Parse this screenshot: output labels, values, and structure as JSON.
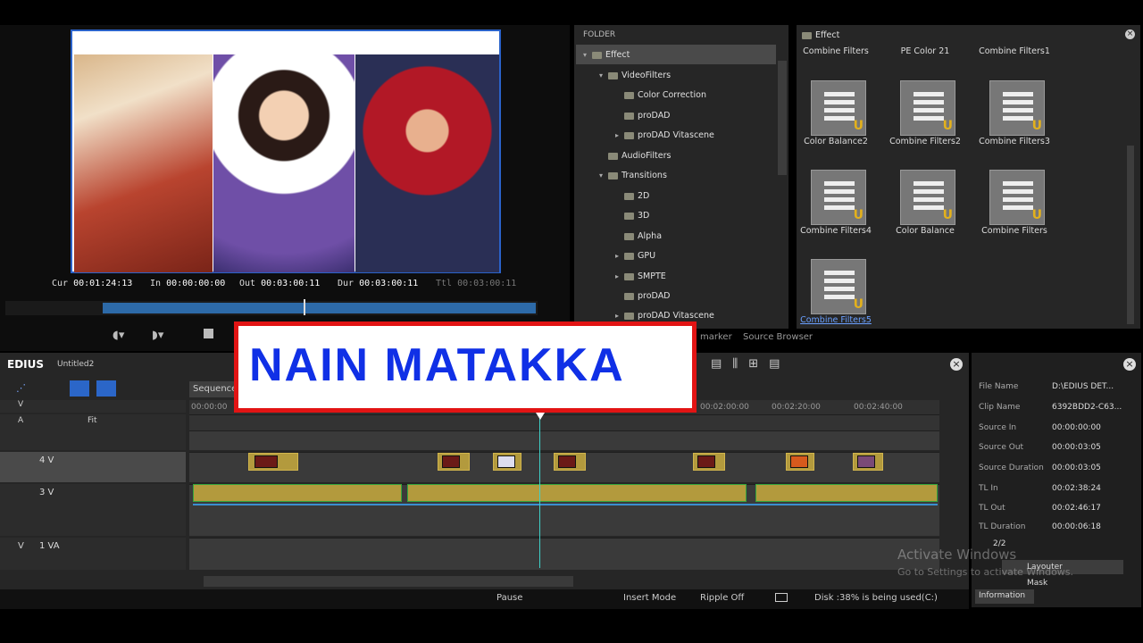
{
  "preview": {
    "cur_label": "Cur",
    "cur": "00:01:24:13",
    "in_label": "In",
    "in": "00:00:00:00",
    "out_label": "Out",
    "out": "00:03:00:11",
    "dur_label": "Dur",
    "dur": "00:03:00:11",
    "ttl_label": "Ttl",
    "ttl": "00:03:00:11"
  },
  "folder": {
    "title": "FOLDER",
    "items": [
      {
        "label": "Effect",
        "expanded": true
      },
      {
        "label": "VideoFilters",
        "expanded": true
      },
      {
        "label": "Color Correction"
      },
      {
        "label": "proDAD"
      },
      {
        "label": "proDAD Vitascene",
        "expanded": false
      },
      {
        "label": "AudioFilters"
      },
      {
        "label": "Transitions",
        "expanded": true
      },
      {
        "label": "2D"
      },
      {
        "label": "3D"
      },
      {
        "label": "Alpha"
      },
      {
        "label": "GPU",
        "expanded": false
      },
      {
        "label": "SMPTE",
        "expanded": false
      },
      {
        "label": "proDAD"
      },
      {
        "label": "proDAD Vitascene",
        "expanded": false
      }
    ]
  },
  "effect": {
    "title": "Effect",
    "headers": [
      "Combine Filters",
      "PE Color 21",
      "Combine Filters1"
    ],
    "items": [
      {
        "label": "Color Balance2",
        "icon": "sliders-icon"
      },
      {
        "label": "Combine Filters2",
        "icon": "layers-icon"
      },
      {
        "label": "Combine Filters3",
        "icon": "layers-icon"
      },
      {
        "label": "Combine Filters4",
        "icon": "layers-icon"
      },
      {
        "label": "Color Balance",
        "icon": "sliders-icon"
      },
      {
        "label": "Combine Filters",
        "icon": "layers-icon"
      },
      {
        "label": "Combine Filters5",
        "icon": "layers-icon",
        "selected": true
      }
    ],
    "tabs": [
      "marker",
      "Source Browser"
    ]
  },
  "app": {
    "name": "EDIUS",
    "project": "Untitled2"
  },
  "timeline": {
    "sequence_tab": "Sequence",
    "ruler": [
      "00:00:00",
      "00:02:00:00",
      "00:02:20:00",
      "00:02:40:00"
    ],
    "tracks": [
      {
        "type": "V",
        "name": ""
      },
      {
        "type": "A",
        "name": "Fit"
      },
      {
        "type": "",
        "name": "4 V"
      },
      {
        "type": "",
        "name": "3 V"
      },
      {
        "type": "V",
        "name": "1 VA"
      }
    ]
  },
  "status": {
    "pause": "Pause",
    "insert": "Insert Mode",
    "ripple": "Ripple Off",
    "disk": "Disk :38% is being used(C:)"
  },
  "info": {
    "rows": [
      {
        "k": "File Name",
        "v": "D:\\EDIUS DET..."
      },
      {
        "k": "Clip Name",
        "v": "6392BDD2-C63..."
      },
      {
        "k": "Source In",
        "v": "00:00:00:00"
      },
      {
        "k": "Source Out",
        "v": "00:00:03:05"
      },
      {
        "k": "Source Duration",
        "v": "00:00:03:05"
      },
      {
        "k": "TL In",
        "v": "00:02:38:24"
      },
      {
        "k": "TL Out",
        "v": "00:02:46:17"
      },
      {
        "k": "TL Duration",
        "v": "00:00:06:18"
      }
    ],
    "count": "2/2",
    "layer1": "Layouter",
    "layer2": "Mask",
    "tab": "Information"
  },
  "banner": {
    "text": "NAIN MATAKKA"
  },
  "watermark": {
    "line1": "Activate Windows",
    "line2": "Go to Settings to activate Windows."
  }
}
